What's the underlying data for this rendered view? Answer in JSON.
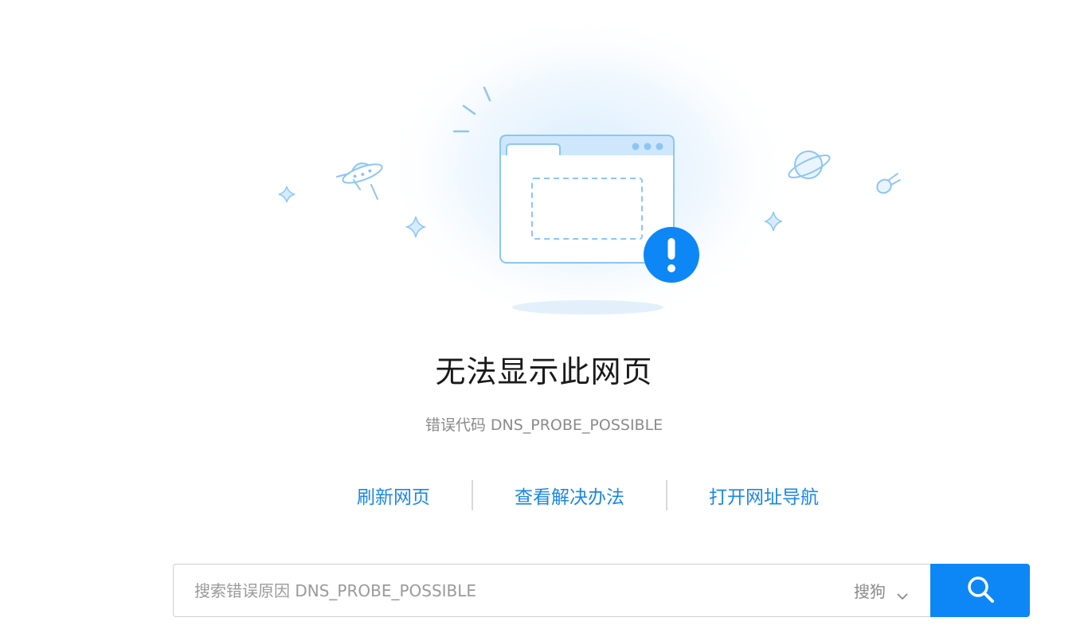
{
  "page": {
    "title": "无法显示此网页",
    "error_code": "错误代码 DNS_PROBE_POSSIBLE"
  },
  "actions": [
    {
      "label": "刷新网页"
    },
    {
      "label": "查看解决办法"
    },
    {
      "label": "打开网址导航"
    }
  ],
  "search": {
    "placeholder": "搜索错误原因 DNS_PROBE_POSSIBLE",
    "value": "",
    "engine": "搜狗"
  },
  "icons": {
    "hero": "browser-window-error-icon",
    "alert": "exclamation-icon",
    "ufo": "ufo-icon",
    "planet": "planet-icon",
    "comet": "comet-icon",
    "sparkle": "sparkle-icon",
    "search": "search-icon",
    "dropdown": "chevron-down-icon"
  },
  "colors": {
    "accent": "#0d87f5",
    "link": "#1a87e6",
    "illustration_stroke": "#8cc6f5",
    "illustration_fill": "#dceefd"
  }
}
